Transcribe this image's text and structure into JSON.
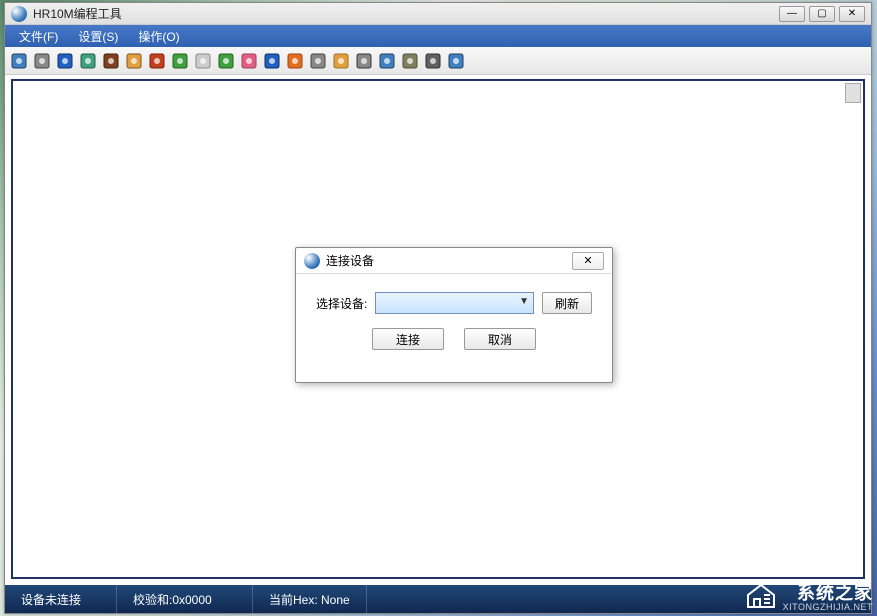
{
  "window": {
    "title": "HR10M编程工具"
  },
  "menubar": {
    "items": [
      {
        "label": "文件(F)"
      },
      {
        "label": "设置(S)"
      },
      {
        "label": "操作(O)"
      }
    ]
  },
  "toolbar": {
    "icons": [
      {
        "name": "save-icon",
        "fill": "#4080c0",
        "stroke": "#204060"
      },
      {
        "name": "settings-icon",
        "fill": "#888",
        "stroke": "#444"
      },
      {
        "name": "device-icon",
        "fill": "#2060c0",
        "stroke": "#103060"
      },
      {
        "name": "copy-icon",
        "fill": "#40a080",
        "stroke": "#206040"
      },
      {
        "name": "camera-icon",
        "fill": "#804020",
        "stroke": "#402010"
      },
      {
        "name": "folder-icon",
        "fill": "#e0a040",
        "stroke": "#805020"
      },
      {
        "name": "write-icon",
        "fill": "#c04020",
        "stroke": "#802010"
      },
      {
        "name": "upload-icon",
        "fill": "#40a040",
        "stroke": "#206020"
      },
      {
        "name": "divider-icon",
        "fill": "#ccc",
        "stroke": "#888"
      },
      {
        "name": "download-icon",
        "fill": "#40a040",
        "stroke": "#206020"
      },
      {
        "name": "erase-icon",
        "fill": "#e06080",
        "stroke": "#a04060"
      },
      {
        "name": "stop-icon",
        "fill": "#2060c0",
        "stroke": "#103060"
      },
      {
        "name": "burn-icon",
        "fill": "#e07020",
        "stroke": "#a04010"
      },
      {
        "name": "zoom-icon",
        "fill": "#888",
        "stroke": "#444"
      },
      {
        "name": "lock-icon",
        "fill": "#e0a040",
        "stroke": "#a07020"
      },
      {
        "name": "text-icon",
        "fill": "#888",
        "stroke": "#333"
      },
      {
        "name": "user-icon",
        "fill": "#4080c0",
        "stroke": "#204060"
      },
      {
        "name": "target-icon",
        "fill": "#808060",
        "stroke": "#505030"
      },
      {
        "name": "setting2-icon",
        "fill": "#606060",
        "stroke": "#303030"
      },
      {
        "name": "window-icon",
        "fill": "#4080c0",
        "stroke": "#204060"
      }
    ]
  },
  "dialog": {
    "title": "连接设备",
    "select_label": "选择设备:",
    "refresh_label": "刷新",
    "connect_label": "连接",
    "cancel_label": "取消"
  },
  "statusbar": {
    "connection": "设备未连接",
    "checksum": "校验和:0x0000",
    "hex": "当前Hex: None"
  },
  "watermark": {
    "cn": "系统之家",
    "en": "XITONGZHIJIA.NET"
  }
}
